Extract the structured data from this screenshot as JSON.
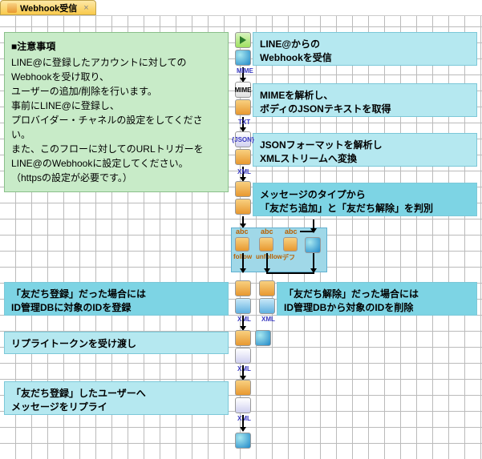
{
  "tab": {
    "icon": "gear-icon",
    "title": "Webhook受信",
    "close": "×"
  },
  "note": {
    "title": "■注意事項",
    "l1": "LINE@に登録したアカウントに対しての",
    "l2": "Webhookを受け取り、",
    "l3": "ユーザーの追加/削除を行います。",
    "l4": "事前にLINE@に登録し、",
    "l5": "プロバイダー・チャネルの設定をしてください。",
    "l6": "また、このフローに対してのURLトリガーを",
    "l7": "LINE@のWebhookに設定してください。",
    "l8": "（httpsの設定が必要です。）"
  },
  "steps": {
    "s1a": "LINE@からの",
    "s1b": "Webhookを受信",
    "s2a": "MIMEを解析し、",
    "s2b": "ボディのJSONテキストを取得",
    "s3a": "JSONフォーマットを解析し",
    "s3b": "XMLストリームへ変換",
    "s4a": "メッセージのタイプから",
    "s4b": "「友だち追加」と「友だち解除」を判別",
    "leftReg1": "「友だち登録」だった場合には",
    "leftReg2": "ID管理DBに対象のIDを登録",
    "rightDel1": "「友だち解除」だった場合には",
    "rightDel2": "ID管理DBから対象のIDを削除",
    "reply": "リプライトークンを受け渡し",
    "msg1": "「友だち登録」したユーザーへ",
    "msg2": "メッセージをリプライ"
  },
  "branch": {
    "b1": "follow",
    "b2": "unfollow",
    "b3": "デフ"
  },
  "iconLabels": {
    "mime": "MIME",
    "txt": "TXT",
    "json": "{JSON}",
    "xml": "XML",
    "abc": "abc"
  }
}
